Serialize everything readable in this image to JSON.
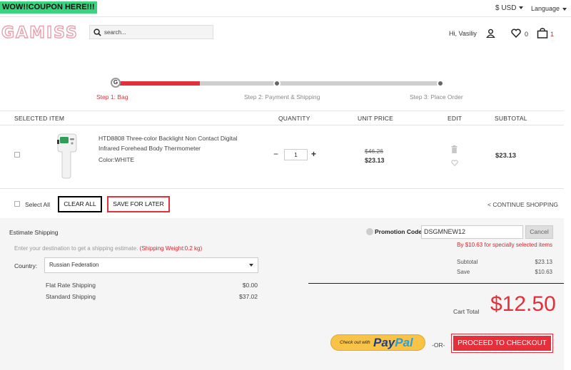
{
  "topbar": {
    "coupon": "WOW!!COUPON HERE!!!",
    "currency": "$  USD",
    "language": "Language"
  },
  "header": {
    "logo": "GAMISS",
    "search_placeholder": "search...",
    "greeting": "Hi, Vasiliy",
    "wishlist_count": "0",
    "bag_count": "1"
  },
  "steps": [
    {
      "label": "Step 1: Bag",
      "active": true
    },
    {
      "label": "Step 2: Payment & Shipping",
      "active": false
    },
    {
      "label": "Step 3: Place Order",
      "active": false
    }
  ],
  "progress": 0.26,
  "table": {
    "headers": {
      "item": "SELECTED ITEM",
      "quantity": "QUANTITY",
      "unit_price": "UNIT PRICE",
      "edit": "EDIT",
      "subtotal": "SUBTOTAL"
    },
    "rows": [
      {
        "name": "HTD8808 Three-color Backlight Non Contact Digital Infrared Forehead Body Thermometer",
        "color": "Color:WHITE",
        "quantity": "1",
        "old_price": "$46.26",
        "price": "$23.13",
        "subtotal": "$23.13"
      }
    ]
  },
  "actions": {
    "select_all": "Select All",
    "clear_all": "CLEAR ALL",
    "save_for_later": "SAVE FOR LATER",
    "continue_shopping": "< CONTINUE SHOPPING"
  },
  "shipping": {
    "title": "Estimate Shipping",
    "hint": "Enter your destination to get a shipping estimate.",
    "hint_weight": "(Shipping Weight:0.2 kg)",
    "country_label": "Country:",
    "country_value": "Russian Federation",
    "options": [
      {
        "name": "Flat Rate Shipping",
        "price": "$0.00"
      },
      {
        "name": "Standard Shipping",
        "price": "$37.02"
      }
    ]
  },
  "promo": {
    "label": "Promotion Code:",
    "code": "DSGMNEW12",
    "cancel": "Cancel",
    "note": "By $10.63 for specially selected items"
  },
  "summary": {
    "subtotal_label": "Subtotal",
    "subtotal": "$23.13",
    "save_label": "Save",
    "save": "$10.63",
    "cart_total_label": "Cart Total",
    "cart_total": "$12.50"
  },
  "checkout": {
    "paypal_prefix": "Check out with",
    "paypal_brand_a": "Pay",
    "paypal_brand_b": "Pal",
    "or": "-OR-",
    "proceed": "PROCEED TO CHECKOUT"
  },
  "colors": {
    "accent": "#e52f3a",
    "coupon_bg": "#3ad47e",
    "paypal_bg": "#f8c347"
  }
}
